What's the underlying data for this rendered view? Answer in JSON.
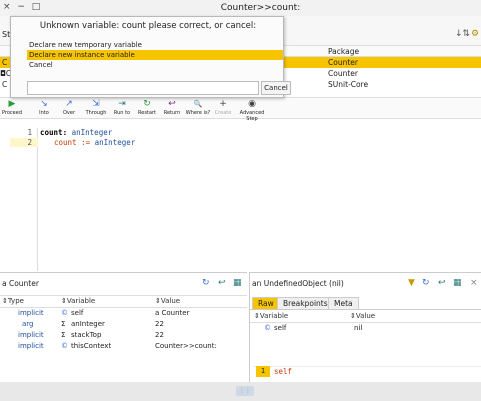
{
  "window": {
    "controls": "× − □",
    "title": "Counter>>count:"
  },
  "stack_header": {
    "label": "St",
    "sort_icon": "sort-icon",
    "extra_icon": "extra-icon"
  },
  "stack_list": {
    "package_header": "Package",
    "rows": [
      {
        "marker": "C",
        "package": "Counter",
        "selected": true
      },
      {
        "marker": "◘C",
        "package": "Counter",
        "selected": false
      },
      {
        "marker": "C",
        "package": "SUnit-Core",
        "selected": false
      }
    ]
  },
  "toolbar": {
    "items": [
      {
        "label": "Proceed",
        "icon": "▶"
      },
      {
        "label": "Into",
        "icon": "↘"
      },
      {
        "label": "Over",
        "icon": "↗"
      },
      {
        "label": "Through",
        "icon": "⇲"
      },
      {
        "label": "Run to",
        "icon": "⇥"
      },
      {
        "label": "Restart",
        "icon": "↻"
      },
      {
        "label": "Return",
        "icon": "↩"
      },
      {
        "label": "Where is?",
        "icon": "🔍"
      },
      {
        "label": "Create",
        "icon": "+"
      },
      {
        "label": "Advanced Step",
        "icon": "◉"
      }
    ]
  },
  "code": {
    "line1_num": "1",
    "line2_num": "2",
    "line1_selector": "count:",
    "line1_arg": "anInteger",
    "line2_var": "count",
    "line2_op": ":=",
    "line2_arg": "anInteger"
  },
  "left_pane": {
    "title": "a Counter",
    "headers": {
      "type": "Type",
      "variable": "Variable",
      "value": "Value"
    },
    "rows": [
      {
        "type": "implicit",
        "icon": "©",
        "variable": "self",
        "value": "a Counter"
      },
      {
        "type": "arg",
        "icon": "Σ",
        "variable": "anInteger",
        "value": "22"
      },
      {
        "type": "implicit",
        "icon": "Σ",
        "variable": "stackTop",
        "value": "22"
      },
      {
        "type": "implicit",
        "icon": "©",
        "variable": "thisContext",
        "value": "Counter>>count:"
      }
    ]
  },
  "right_pane": {
    "title": "an UndefinedObject (nil)",
    "tabs": [
      "Raw",
      "Breakpoints",
      "Meta"
    ],
    "headers": {
      "variable": "Variable",
      "value": "Value"
    },
    "rows": [
      {
        "icon": "©",
        "variable": "self",
        "value": "nil"
      }
    ],
    "code_line_num": "1",
    "code_line": "self"
  },
  "dialog": {
    "title": "Unknown variable: count please correct, or cancel:",
    "items": [
      {
        "label": "Declare new temporary variable",
        "selected": false
      },
      {
        "label": "Declare new instance variable",
        "selected": true
      },
      {
        "label": "Cancel",
        "selected": false
      }
    ],
    "input_value": "",
    "cancel_button": "Cancel"
  },
  "colors": {
    "selection": "#f6c400",
    "accent_blue": "#1d4f9a",
    "accent_red": "#c43a00"
  }
}
